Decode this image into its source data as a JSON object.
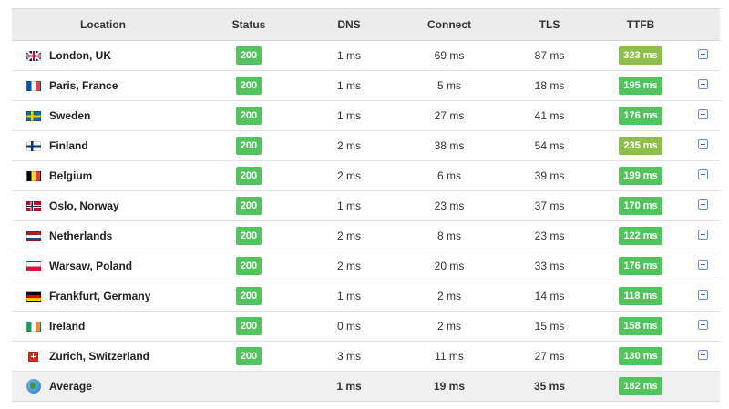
{
  "headers": {
    "location": "Location",
    "status": "Status",
    "dns": "DNS",
    "connect": "Connect",
    "tls": "TLS",
    "ttfb": "TTFB"
  },
  "colors": {
    "status_green": "#52c45d",
    "ttfb_green": "#52c45d",
    "ttfb_yellow_green": "#8dbf4a",
    "expand_icon_blue": "#4a72c9"
  },
  "rows": [
    {
      "flag": "uk-flag-icon",
      "location": "London, UK",
      "status": "200",
      "dns": "1 ms",
      "connect": "69 ms",
      "tls": "87 ms",
      "ttfb": "323 ms",
      "ttfb_color": "#8dbf4a"
    },
    {
      "flag": "france-flag-icon",
      "location": "Paris, France",
      "status": "200",
      "dns": "1 ms",
      "connect": "5 ms",
      "tls": "18 ms",
      "ttfb": "195 ms",
      "ttfb_color": "#52c45d"
    },
    {
      "flag": "sweden-flag-icon",
      "location": "Sweden",
      "status": "200",
      "dns": "1 ms",
      "connect": "27 ms",
      "tls": "41 ms",
      "ttfb": "176 ms",
      "ttfb_color": "#52c45d"
    },
    {
      "flag": "finland-flag-icon",
      "location": "Finland",
      "status": "200",
      "dns": "2 ms",
      "connect": "38 ms",
      "tls": "54 ms",
      "ttfb": "235 ms",
      "ttfb_color": "#8dbf4a"
    },
    {
      "flag": "belgium-flag-icon",
      "location": "Belgium",
      "status": "200",
      "dns": "2 ms",
      "connect": "6 ms",
      "tls": "39 ms",
      "ttfb": "199 ms",
      "ttfb_color": "#52c45d"
    },
    {
      "flag": "norway-flag-icon",
      "location": "Oslo, Norway",
      "status": "200",
      "dns": "1 ms",
      "connect": "23 ms",
      "tls": "37 ms",
      "ttfb": "170 ms",
      "ttfb_color": "#52c45d"
    },
    {
      "flag": "netherlands-flag-icon",
      "location": "Netherlands",
      "status": "200",
      "dns": "2 ms",
      "connect": "8 ms",
      "tls": "23 ms",
      "ttfb": "122 ms",
      "ttfb_color": "#52c45d"
    },
    {
      "flag": "poland-flag-icon",
      "location": "Warsaw, Poland",
      "status": "200",
      "dns": "2 ms",
      "connect": "20 ms",
      "tls": "33 ms",
      "ttfb": "176 ms",
      "ttfb_color": "#52c45d"
    },
    {
      "flag": "germany-flag-icon",
      "location": "Frankfurt, Germany",
      "status": "200",
      "dns": "1 ms",
      "connect": "2 ms",
      "tls": "14 ms",
      "ttfb": "118 ms",
      "ttfb_color": "#52c45d"
    },
    {
      "flag": "ireland-flag-icon",
      "location": "Ireland",
      "status": "200",
      "dns": "0 ms",
      "connect": "2 ms",
      "tls": "15 ms",
      "ttfb": "158 ms",
      "ttfb_color": "#52c45d"
    },
    {
      "flag": "switzerland-flag-icon",
      "location": "Zurich, Switzerland",
      "status": "200",
      "dns": "3 ms",
      "connect": "11 ms",
      "tls": "27 ms",
      "ttfb": "130 ms",
      "ttfb_color": "#52c45d"
    }
  ],
  "average": {
    "icon": "globe-icon",
    "location": "Average",
    "dns": "1 ms",
    "connect": "19 ms",
    "tls": "35 ms",
    "ttfb": "182 ms",
    "ttfb_color": "#52c45d"
  }
}
